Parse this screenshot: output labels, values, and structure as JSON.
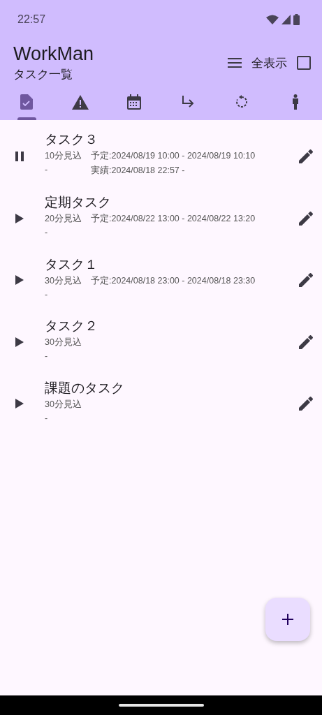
{
  "status_bar": {
    "time": "22:57"
  },
  "app_bar": {
    "title": "WorkMan",
    "subtitle": "タスク一覧",
    "filter_label": "全表示",
    "show_all_checked": false
  },
  "tabs": [
    {
      "kind": "task",
      "selected": true
    },
    {
      "kind": "warning",
      "selected": false
    },
    {
      "kind": "calendar",
      "selected": false
    },
    {
      "kind": "subtask",
      "selected": false
    },
    {
      "kind": "repeat",
      "selected": false
    },
    {
      "kind": "person",
      "selected": false
    }
  ],
  "tasks": [
    {
      "title": "タスク３",
      "running": true,
      "estimate": "10分見込",
      "schedule": "予定:2024/08/19 10:00 - 2024/08/19 10:10",
      "note": "-",
      "actual": "実績:2024/08/18 22:57 -"
    },
    {
      "title": "定期タスク",
      "running": false,
      "estimate": "20分見込",
      "schedule": "予定:2024/08/22 13:00 - 2024/08/22 13:20",
      "note": "-"
    },
    {
      "title": "タスク１",
      "running": false,
      "estimate": "30分見込",
      "schedule": "予定:2024/08/18 23:00 - 2024/08/18 23:30",
      "note": "-"
    },
    {
      "title": "タスク２",
      "running": false,
      "estimate": "30分見込",
      "note": "-"
    },
    {
      "title": "課題のタスク",
      "running": false,
      "estimate": "30分見込",
      "note": "-"
    }
  ]
}
